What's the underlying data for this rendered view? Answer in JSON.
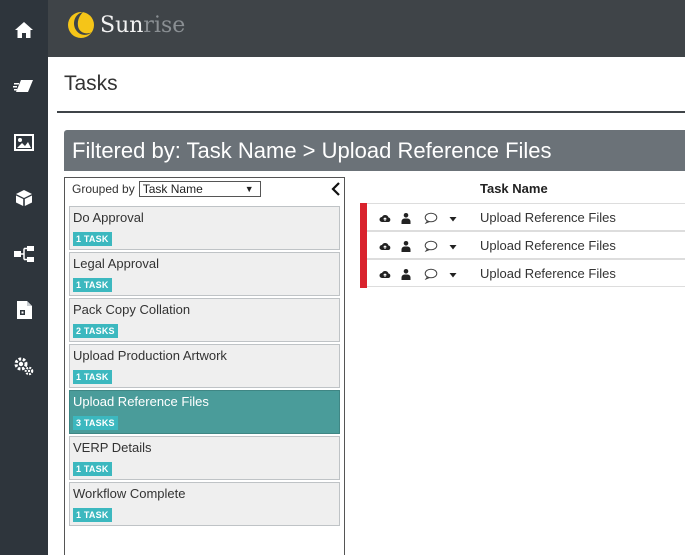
{
  "app": {
    "logo_part1": "Sun",
    "logo_part2": "rise"
  },
  "sidebar": {
    "items": [
      {
        "icon": "home-icon"
      },
      {
        "icon": "eraser-icon"
      },
      {
        "icon": "image-icon"
      },
      {
        "icon": "box-icon"
      },
      {
        "icon": "hierarchy-icon"
      },
      {
        "icon": "document-icon"
      },
      {
        "icon": "gears-icon"
      }
    ]
  },
  "page": {
    "title": "Tasks"
  },
  "filter": {
    "text": "Filtered by: Task Name > Upload Reference Files"
  },
  "grouping": {
    "label": "Grouped by",
    "selected": "Task Name",
    "groups": [
      {
        "name": "Do Approval",
        "count": "1 TASK",
        "selected": false
      },
      {
        "name": "Legal Approval",
        "count": "1 TASK",
        "selected": false
      },
      {
        "name": "Pack Copy Collation",
        "count": "2 TASKS",
        "selected": false
      },
      {
        "name": "Upload Production Artwork",
        "count": "1 TASK",
        "selected": false
      },
      {
        "name": "Upload Reference Files",
        "count": "3 TASKS",
        "selected": true
      },
      {
        "name": "VERP Details",
        "count": "1 TASK",
        "selected": false
      },
      {
        "name": "Workflow Complete",
        "count": "1 TASK",
        "selected": false
      }
    ]
  },
  "tasks": {
    "column_header": "Task Name",
    "rows": [
      {
        "name": "Upload Reference Files"
      },
      {
        "name": "Upload Reference Files"
      },
      {
        "name": "Upload Reference Files"
      }
    ]
  },
  "colors": {
    "sidebar": "#2e353c",
    "topbar": "#3f4448",
    "filter_bar": "#6b7278",
    "selected_group": "#4a9c9a",
    "badge": "#3cb8bf",
    "task_status": "#d9232d",
    "logo_sun": "#f5c518"
  }
}
